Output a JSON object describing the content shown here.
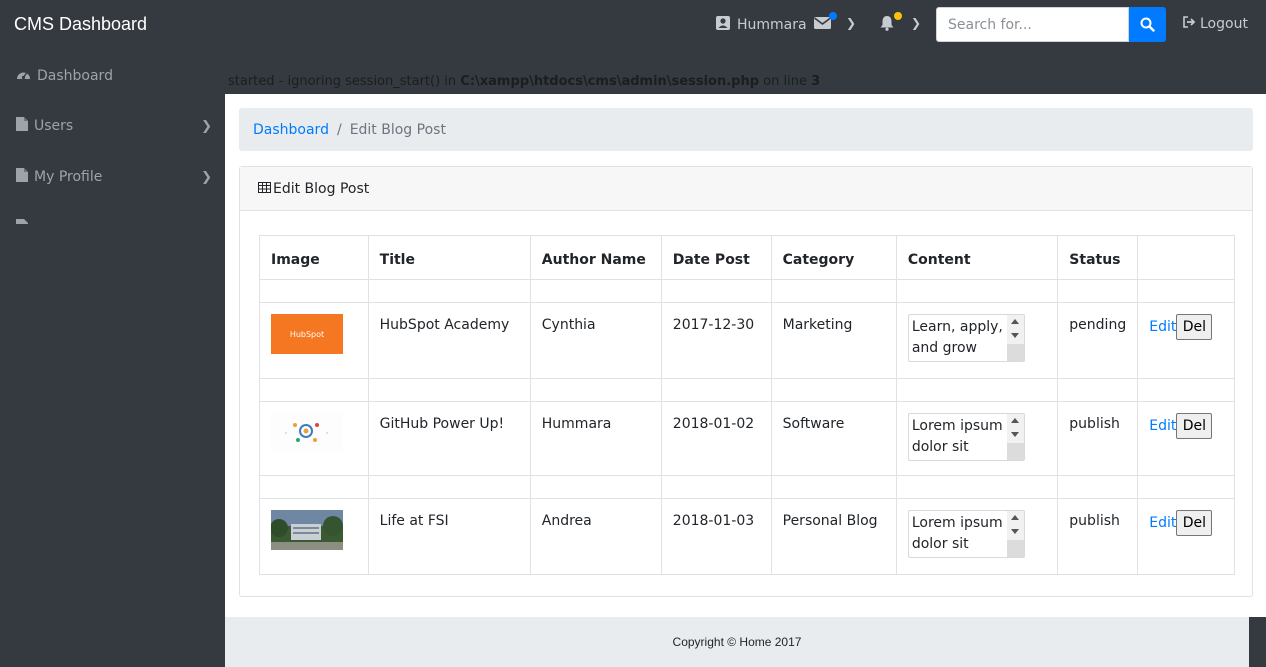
{
  "navbar": {
    "brand": "CMS Dashboard",
    "user_name": "Hummara",
    "mail_dot_color": "#007bff",
    "bell_dot_color": "#ffc107",
    "search_placeholder": "Search for...",
    "logout_label": "Logout"
  },
  "sidebar": {
    "items": [
      {
        "label": "Dashboard",
        "icon": "dashboard-icon"
      },
      {
        "label": "Users",
        "icon": "file-icon"
      },
      {
        "label": "My Profile",
        "icon": "file-icon"
      }
    ]
  },
  "warning": {
    "prefix": "started - ignoring session_start() in ",
    "path": "C:\\xampp\\htdocs\\cms\\admin\\session.php",
    "mid": " on line ",
    "line": "3"
  },
  "breadcrumb": {
    "home": "Dashboard",
    "current": "Edit Blog Post"
  },
  "card": {
    "title": "Edit Blog Post"
  },
  "table": {
    "headers": [
      "Image",
      "Title",
      "Author Name",
      "Date Post",
      "Category",
      "Content",
      "Status",
      ""
    ],
    "rows": [
      {
        "image_text": "HubSpot",
        "title": "HubSpot Academy",
        "author": "Cynthia",
        "date": "2017-12-30",
        "category": "Marketing",
        "content": "Learn, apply, and grow with",
        "status": "pending",
        "edit": "Edit",
        "del": "Del"
      },
      {
        "image_text": "",
        "title": "GitHub Power Up!",
        "author": "Hummara",
        "date": "2018-01-02",
        "category": "Software",
        "content": "Lorem ipsum dolor sit amet,",
        "status": "publish",
        "edit": "Edit",
        "del": "Del"
      },
      {
        "image_text": "",
        "title": "Life at FSI",
        "author": "Andrea",
        "date": "2018-01-03",
        "category": "Personal Blog",
        "content": "Lorem ipsum dolor sit amet,",
        "status": "publish",
        "edit": "Edit",
        "del": "Del"
      }
    ]
  },
  "footer": {
    "text": "Copyright © Home 2017"
  }
}
